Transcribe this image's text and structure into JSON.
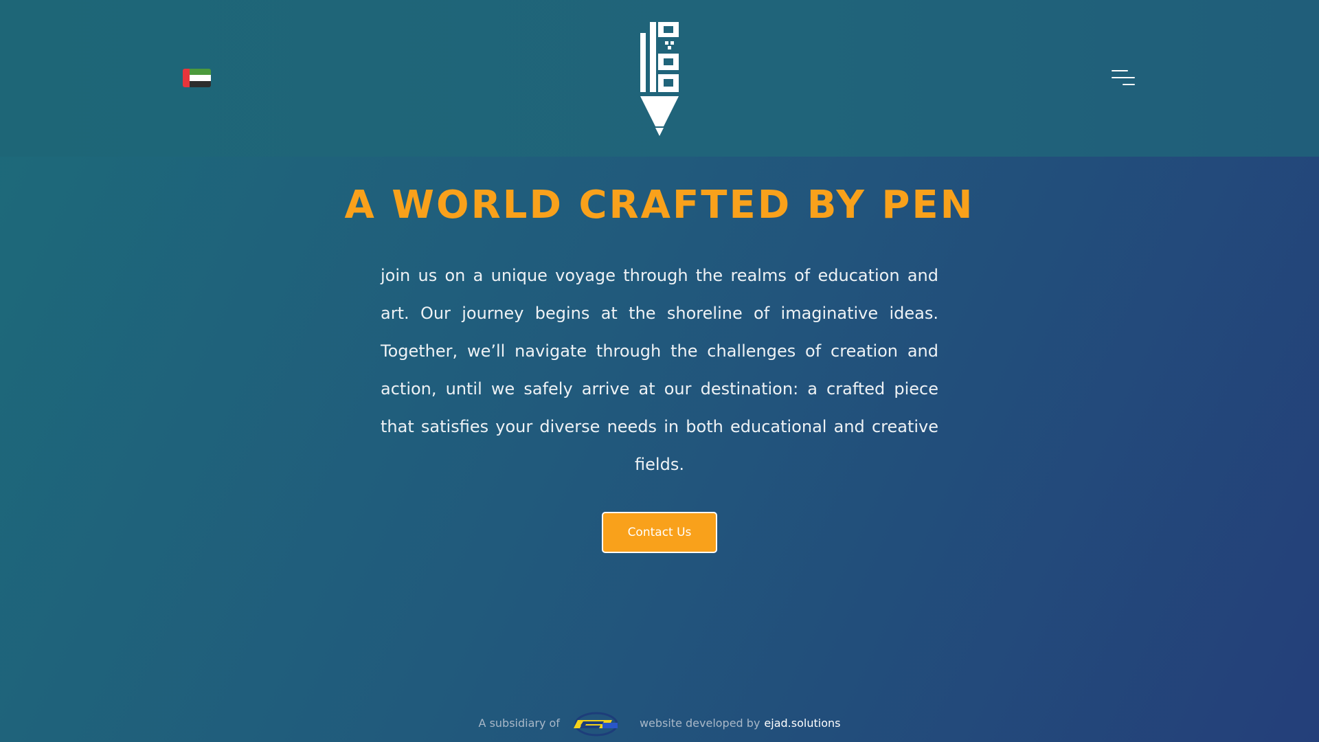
{
  "header": {
    "language_flag": {
      "icon": "uae-flag-icon"
    },
    "logo": {
      "icon": "pen-calligraphy-logo"
    },
    "menu": {
      "icon": "hamburger-menu-icon"
    }
  },
  "hero": {
    "title": "A WORLD CRAFTED BY PEN",
    "description": "join us on a unique voyage through the realms of education and art. Our journey begins at the shoreline of imaginative ideas. Together, we’ll navigate through the challenges of creation and action, until we safely arrive at our destination: a crafted piece that satisfies your diverse needs in both educational and creative fields.",
    "cta_label": "Contact Us"
  },
  "footer": {
    "subsidiary_label": "A subsidiary of",
    "parent_logo": {
      "icon": "parent-company-logo"
    },
    "developed_label": "website developed by",
    "developer_link": "ejad.solutions"
  },
  "colors": {
    "accent": "#f9a11b",
    "background_start": "#1d6b7a",
    "background_end": "#243f7a",
    "text": "#f3f6f8"
  }
}
